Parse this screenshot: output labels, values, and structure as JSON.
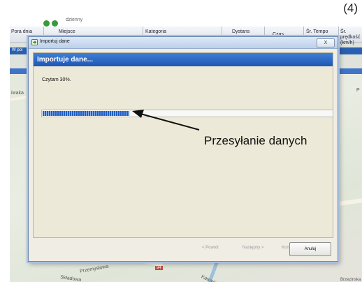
{
  "page_number": "(4)",
  "background_app": {
    "top_label": "dzienny",
    "columns": [
      {
        "label": "Pora dnia"
      },
      {
        "label": "Miejsce"
      },
      {
        "label": "Kategoria"
      },
      {
        "label": "Dystans"
      },
      {
        "label": "Czas"
      },
      {
        "label": "Śr. Tempo"
      },
      {
        "label": "Śr. prędkość (km/h)"
      }
    ],
    "tab_label": "W pol",
    "map_labels": {
      "left": "iwaka",
      "right_top": "P",
      "right_bottom": "Brzezinska",
      "street_1": "Przemysłowa",
      "street_2": "Składowa",
      "street_3": "Katowic",
      "badge": "94"
    }
  },
  "dialog": {
    "window_title": "Importuj dane",
    "close_label": "X",
    "header": "Importuje dane...",
    "status_text": "Czytam 30%.",
    "progress": 0.3,
    "buttons": {
      "back": "< Powrót",
      "next": "Następny >",
      "finish": "Koniec",
      "cancel": "Anuluj"
    }
  },
  "annotation": "Przesyłanie danych",
  "colors": {
    "header_blue": "#1e57b5",
    "progress_blue": "#1f5fc4"
  }
}
